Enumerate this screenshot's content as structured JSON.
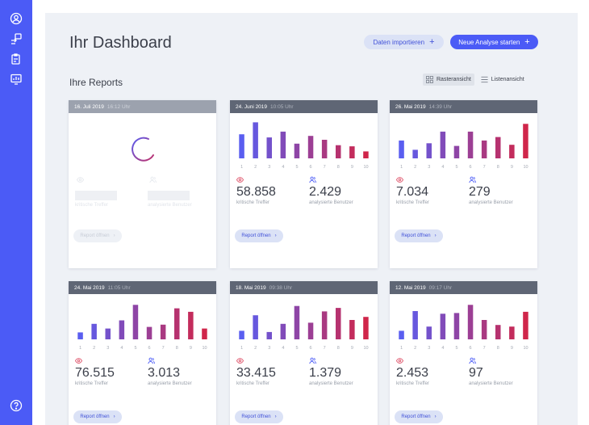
{
  "sidebar": {
    "icons": [
      "user-circle-icon",
      "transfer-icon",
      "clipboard-icon",
      "report-icon"
    ],
    "help_icon": "help-icon"
  },
  "header": {
    "title": "Ihr Dashboard",
    "import_label": "Daten importieren",
    "new_label": "Neue Analyse starten",
    "plus": "+"
  },
  "reports": {
    "subtitle": "Ihre Reports",
    "view_grid": "Rasteransicht",
    "view_list": "Listenansicht",
    "open_label": "Report öffnen",
    "arrow": "›",
    "label_hits": "kritische Treffer",
    "label_users": "analysierte Benutzer",
    "cards": [
      {
        "date": "16. Juli 2019",
        "time": "16:12 Uhr",
        "loading": true
      },
      {
        "date": "24. Juni 2019",
        "time": "10:05 Uhr",
        "hits": "58.858",
        "users": "2.429"
      },
      {
        "date": "26. Mai 2019",
        "time": "14:39 Uhr",
        "hits": "7.034",
        "users": "279"
      },
      {
        "date": "24. Mai 2019",
        "time": "11:05 Uhr",
        "hits": "76.515",
        "users": "3.013"
      },
      {
        "date": "18. Mai 2019",
        "time": "09:38 Uhr",
        "hits": "33.415",
        "users": "1.379"
      },
      {
        "date": "12. Mai 2019",
        "time": "09:17 Uhr",
        "hits": "2.453",
        "users": "97"
      }
    ]
  },
  "colors": {
    "accent": "#4b5bf6",
    "bar_start": "#5a5ef0",
    "bar_end": "#d0264a",
    "eye_icon": "#e05a70",
    "user_icon": "#4b5bf6"
  },
  "chart_data": [
    {
      "type": "bar",
      "categories": [
        "1",
        "2",
        "3",
        "4",
        "5",
        "6",
        "7",
        "8",
        "9",
        "10"
      ],
      "values": [
        0.62,
        0.93,
        0.54,
        0.69,
        0.38,
        0.58,
        0.48,
        0.34,
        0.31,
        0.18
      ]
    },
    {
      "type": "bar",
      "categories": [
        "1",
        "2",
        "3",
        "4",
        "5",
        "6",
        "7",
        "8",
        "9",
        "10"
      ],
      "values": [
        0.46,
        0.22,
        0.39,
        0.69,
        0.32,
        0.69,
        0.46,
        0.55,
        0.35,
        0.89
      ]
    },
    {
      "type": "bar",
      "categories": [
        "1",
        "2",
        "3",
        "4",
        "5",
        "6",
        "7",
        "8",
        "9",
        "10"
      ],
      "values": [
        0.18,
        0.4,
        0.28,
        0.49,
        0.89,
        0.32,
        0.38,
        0.8,
        0.71,
        0.28
      ]
    },
    {
      "type": "bar",
      "categories": [
        "1",
        "2",
        "3",
        "4",
        "5",
        "6",
        "7",
        "8",
        "9",
        "10"
      ],
      "values": [
        0.22,
        0.62,
        0.19,
        0.4,
        0.86,
        0.43,
        0.72,
        0.81,
        0.5,
        0.58
      ]
    },
    {
      "type": "bar",
      "categories": [
        "1",
        "2",
        "3",
        "4",
        "5",
        "6",
        "7",
        "8",
        "9",
        "10"
      ],
      "values": [
        0.22,
        0.73,
        0.33,
        0.66,
        0.68,
        0.89,
        0.5,
        0.37,
        0.33,
        0.71
      ]
    }
  ]
}
